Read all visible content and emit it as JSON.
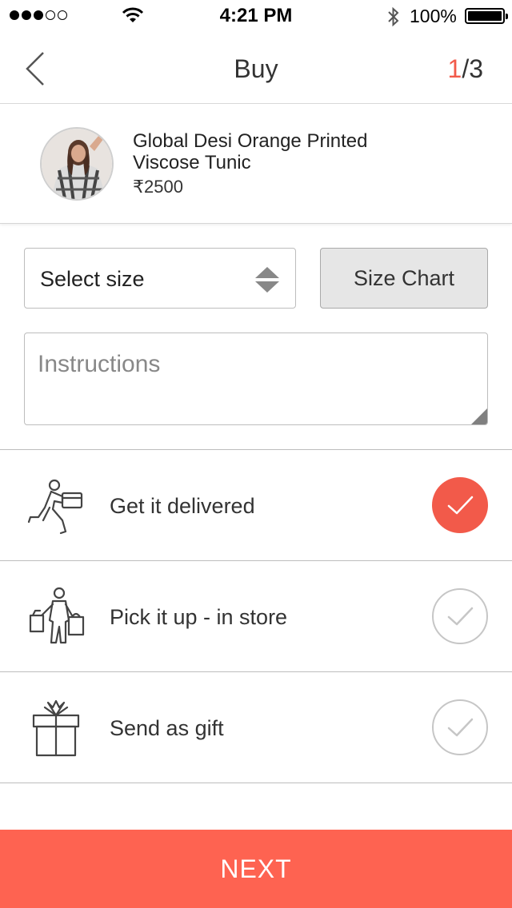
{
  "status_bar": {
    "time": "4:21 PM",
    "battery_percent": "100%"
  },
  "nav": {
    "title": "Buy",
    "step_current": "1",
    "step_total": "/3"
  },
  "product": {
    "name": "Global Desi Orange Printed Viscose Tunic",
    "price": "₹2500"
  },
  "size": {
    "select_label": "Select size",
    "chart_label": "Size Chart"
  },
  "instructions": {
    "placeholder": "Instructions"
  },
  "options": [
    {
      "label": "Get it delivered",
      "icon": "delivery-person-icon",
      "selected": true
    },
    {
      "label": "Pick it up - in store",
      "icon": "shopper-with-bags-icon",
      "selected": false
    },
    {
      "label": "Send as gift",
      "icon": "gift-box-icon",
      "selected": false
    }
  ],
  "next_label": "NEXT",
  "colors": {
    "accent": "#f25a4a",
    "next_button": "#fe6351"
  }
}
